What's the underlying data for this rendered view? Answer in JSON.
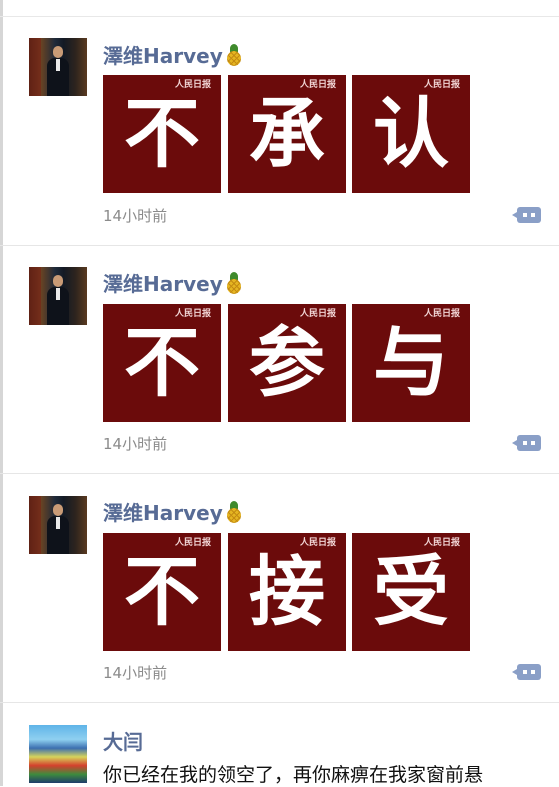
{
  "posts": [
    {
      "author": "澤维Harvey",
      "emoji": "pineapple-icon",
      "images": [
        {
          "char": "不",
          "logo": "人民日报"
        },
        {
          "char": "承",
          "logo": "人民日报"
        },
        {
          "char": "认",
          "logo": "人民日报"
        }
      ],
      "time": "14小时前"
    },
    {
      "author": "澤维Harvey",
      "emoji": "pineapple-icon",
      "images": [
        {
          "char": "不",
          "logo": "人民日报"
        },
        {
          "char": "参",
          "logo": "人民日报"
        },
        {
          "char": "与",
          "logo": "人民日报"
        }
      ],
      "time": "14小时前"
    },
    {
      "author": "澤维Harvey",
      "emoji": "pineapple-icon",
      "images": [
        {
          "char": "不",
          "logo": "人民日报"
        },
        {
          "char": "接",
          "logo": "人民日报"
        },
        {
          "char": "受",
          "logo": "人民日报"
        }
      ],
      "time": "14小时前"
    },
    {
      "author": "大闫",
      "text": "你已经在我的领空了，再你麻痹在我家窗前悬"
    }
  ],
  "colors": {
    "name": "#576b95",
    "tile_bg": "#6b0b0b",
    "comment_button": "#8a9fc7",
    "time": "#8b8b8b"
  }
}
